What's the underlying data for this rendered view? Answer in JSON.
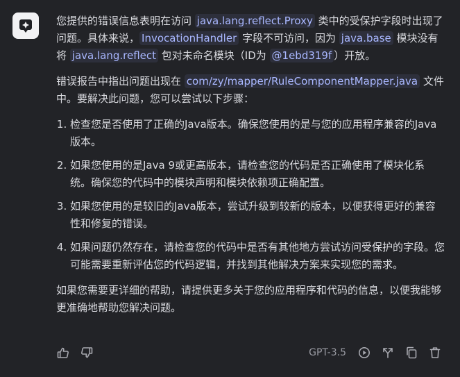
{
  "assistant": {
    "avatar_icon": "sparkle-icon"
  },
  "message": {
    "p1": {
      "t1": "您提供的错误信息表明在访问 ",
      "c1": "java.lang.reflect.Proxy",
      "t2": " 类中的受保护字段时出现了问题。具体来说，",
      "c2": "InvocationHandler",
      "t3": " 字段不可访问，因为 ",
      "c3": "java.base",
      "t4": " 模块没有将 ",
      "c4": "java.lang.reflect",
      "t5": " 包对未命名模块（ID为 ",
      "c5": "@1ebd319f",
      "t6": "）开放。"
    },
    "p2": {
      "t1": "错误报告中指出问题出现在 ",
      "c1": "com/zy/mapper/RuleComponentMapper.java",
      "t2": " 文件中。要解决此问题，您可以尝试以下步骤："
    },
    "steps": [
      "检查您是否使用了正确的Java版本。确保您使用的是与您的应用程序兼容的Java版本。",
      "如果您使用的是Java 9或更高版本，请检查您的代码是否正确使用了模块化系统。确保您的代码中的模块声明和模块依赖项正确配置。",
      "如果您使用的是较旧的Java版本，尝试升级到较新的版本，以便获得更好的兼容性和修复的错误。",
      "如果问题仍然存在，请检查您的代码中是否有其他地方尝试访问受保护的字段。您可能需要重新评估您的代码逻辑，并找到其他解决方案来实现您的需求。"
    ],
    "p3": "如果您需要更详细的帮助，请提供更多关于您的应用程序和代码的信息，以便我能够更准确地帮助您解决问题。"
  },
  "toolbar": {
    "model": "GPT-3.5",
    "icons": [
      "thumbs-up-icon",
      "thumbs-down-icon",
      "play-icon",
      "fork-icon",
      "copy-icon",
      "trash-icon"
    ]
  },
  "colors": {
    "background": "#222327",
    "text": "#d9dadf",
    "code_bg": "#2d2f3b",
    "code_text": "#a9b7ff",
    "muted": "#9a9ba3"
  }
}
